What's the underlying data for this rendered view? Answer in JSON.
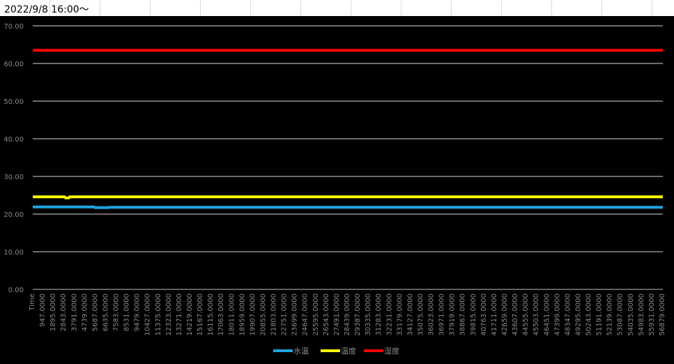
{
  "header": {
    "title": "2022/9/8 16:00～"
  },
  "chart_data": {
    "type": "line",
    "x_axis_label": "Time",
    "x_ticks": [
      "947.0000",
      "1895.0000",
      "2843.0000",
      "3791.0000",
      "4739.0000",
      "5687.0000",
      "6635.0000",
      "7583.0000",
      "8531.0000",
      "9479.0000",
      "10427.0000",
      "11375.0000",
      "12323.0000",
      "13271.0000",
      "14219.0000",
      "15167.0000",
      "16115.0000",
      "17063.0000",
      "18011.0000",
      "18959.0000",
      "19907.0000",
      "20855.0000",
      "21803.0000",
      "22751.0000",
      "23699.0000",
      "24647.0000",
      "25595.0000",
      "26543.0000",
      "27491.0000",
      "28439.0000",
      "29387.0000",
      "30335.0000",
      "31283.0000",
      "32231.0000",
      "33179.0000",
      "34127.0000",
      "35075.0000",
      "36023.0000",
      "36971.0000",
      "37919.0000",
      "38867.0000",
      "39815.0000",
      "40763.0000",
      "41711.0000",
      "42659.0000",
      "43607.0000",
      "44555.0000",
      "45503.0000",
      "46451.0000",
      "47399.0000",
      "48347.0000",
      "49295.0000",
      "50243.0000",
      "51191.0000",
      "52139.0000",
      "53087.0000",
      "54035.0000",
      "54983.0000",
      "55931.0000",
      "56879.0000"
    ],
    "y_ticks": [
      "0.00",
      "10.00",
      "20.00",
      "30.00",
      "40.00",
      "50.00",
      "60.00",
      "70.00"
    ],
    "ylim": [
      0,
      70
    ],
    "grid": true,
    "legend_position": "bottom",
    "series": [
      {
        "name": "水温",
        "color": "#1FA5E0",
        "x": [
          0,
          5600,
          5700,
          6900,
          7000,
          57800
        ],
        "values": [
          21.9,
          21.9,
          21.7,
          21.7,
          21.8,
          21.8
        ]
      },
      {
        "name": "温度",
        "color": "#FFFF00",
        "x": [
          0,
          2900,
          3000,
          3300,
          3400,
          57800
        ],
        "values": [
          24.6,
          24.6,
          24.3,
          24.3,
          24.6,
          24.6
        ]
      },
      {
        "name": "湿度",
        "color": "#FF0000",
        "x": [
          0,
          57800
        ],
        "values": [
          63.5,
          63.5
        ]
      }
    ]
  }
}
